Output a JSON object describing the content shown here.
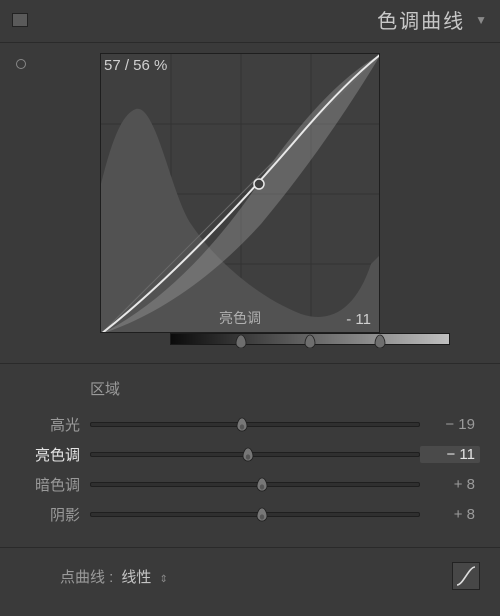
{
  "header": {
    "title": "色调曲线"
  },
  "curve": {
    "readout": "57 / 56 %",
    "region_label": "亮色调",
    "region_value": "- 11",
    "splits": [
      25,
      50,
      75
    ]
  },
  "region_section_label": "区域",
  "sliders": [
    {
      "label": "高光",
      "value_text": "− 19",
      "pos": 46,
      "active": false
    },
    {
      "label": "亮色调",
      "value_text": "− 11",
      "pos": 48,
      "active": true
    },
    {
      "label": "暗色调",
      "value_text": "+ 8",
      "pos": 52,
      "active": false
    },
    {
      "label": "阴影",
      "value_text": "+ 8",
      "pos": 52,
      "active": false
    }
  ],
  "footer": {
    "label": "点曲线 :",
    "selected": "线性"
  }
}
